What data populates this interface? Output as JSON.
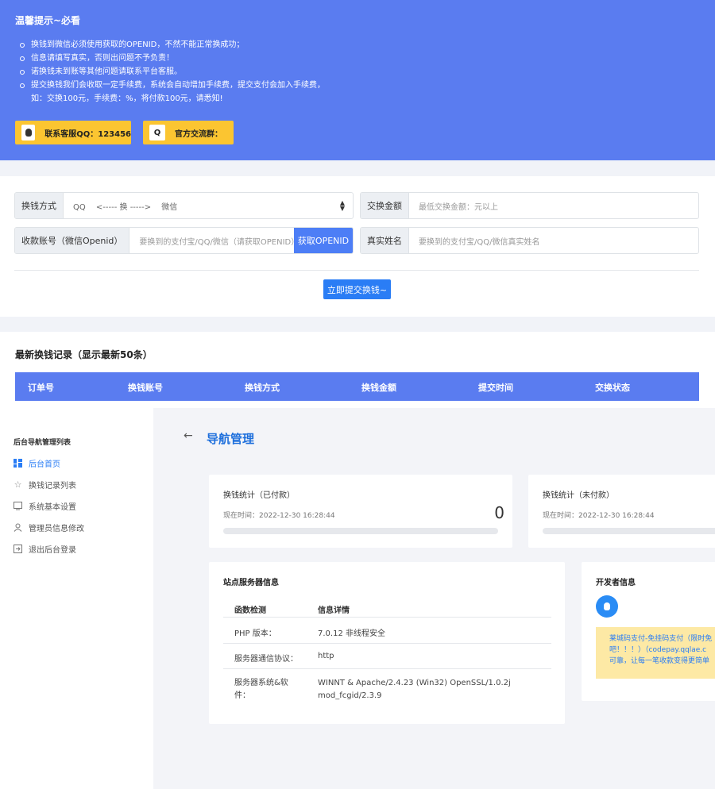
{
  "notice": {
    "title": "温馨提示~必看",
    "items": [
      "换钱到微信必须使用获取的OPENID，不然不能正常换成功；",
      "信息请填写真实，否则出问题不予负责！",
      "诺换钱未到账等其他问题请联系平台客服。",
      "提交换钱我们会收取一定手续费，系统会自动增加手续费，提交支付会加入手续费，",
      "如：交换100元，手续费：%，将付款100元，请悉知!"
    ],
    "qq_button": "联系客服QQ：123456",
    "group_button_icon": "Q",
    "group_button": "官方交流群："
  },
  "form": {
    "method_label": "换钱方式",
    "method_value": "QQ　 <----- 换 -----> 　微信",
    "amount_label": "交换金额",
    "amount_placeholder": "最低交换金额：元以上",
    "account_label": "收款账号（微信Openid）",
    "account_placeholder": "要换到的支付宝/QQ/微信（请获取OPENID）",
    "openid_button": "获取OPENID",
    "name_label": "真实姓名",
    "name_placeholder": "要换到的支付宝/QQ/微信真实姓名",
    "submit": "立即提交换钱~"
  },
  "records": {
    "title": "最新换钱记录（显示最新50条）",
    "columns": [
      "订单号",
      "换钱账号",
      "换钱方式",
      "换钱金额",
      "提交时间",
      "交换状态"
    ]
  },
  "sidebar": {
    "title": "后台导航管理列表",
    "items": [
      {
        "label": "后台首页",
        "icon": "grid-icon"
      },
      {
        "label": "换钱记录列表",
        "icon": "star-icon"
      },
      {
        "label": "系统基本设置",
        "icon": "monitor-icon"
      },
      {
        "label": "管理员信息修改",
        "icon": "user-icon"
      },
      {
        "label": "退出后台登录",
        "icon": "logout-icon"
      }
    ]
  },
  "main": {
    "title": "导航管理",
    "stat_paid": {
      "title": "换钱统计（已付款）",
      "time": "现在时间：2022-12-30 16:28:44",
      "value": "0"
    },
    "stat_unpaid": {
      "title": "换钱统计（未付款）",
      "time": "现在时间：2022-12-30 16:28:44"
    },
    "server": {
      "title": "站点服务器信息",
      "header": [
        "函数检测",
        "信息详情"
      ],
      "rows": [
        {
          "k": "PHP 版本：",
          "v": "7.0.12 非线程安全"
        },
        {
          "k": "服务器通信协议：",
          "v": "http"
        },
        {
          "k1": "服务器系统&软",
          "k2": "件：",
          "v1": "WINNT & Apache/2.4.23 (Win32) OpenSSL/1.0.2j",
          "v2": "mod_fcgid/2.3.9"
        }
      ]
    },
    "developer": {
      "title": "开发者信息",
      "lines": [
        "莱城码支付-免挂码支付（限时免",
        "吧！！！）（codepay.qqlae.c",
        "可靠，让每一笔收款变得更简单"
      ]
    }
  },
  "colors": {
    "primary": "#5a7cf0",
    "button_yellow": "#fbc531",
    "accent_blue": "#2a7df5"
  }
}
